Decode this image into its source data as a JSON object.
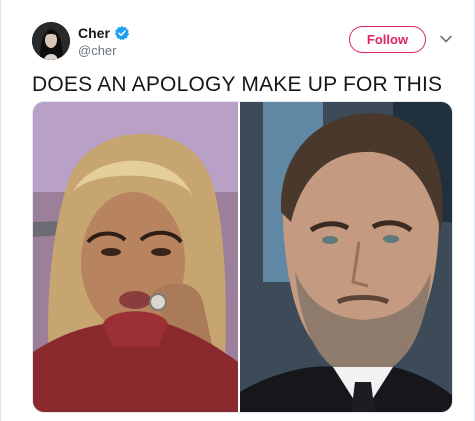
{
  "tweet": {
    "author": {
      "display_name": "Cher",
      "handle": "@cher",
      "verified": true,
      "avatar_icon": "profile-photo"
    },
    "follow_label": "Follow",
    "menu_icon": "chevron-down-icon",
    "text": "DOES AN APOLOGY MAKE UP FOR THIS"
  },
  "colors": {
    "follow_accent": "#e0245e",
    "verified_blue": "#1da1f2",
    "handle_gray": "#657786",
    "text": "#14171a"
  },
  "media": {
    "panels": [
      {
        "description_icon": "photo-left"
      },
      {
        "description_icon": "photo-right"
      }
    ]
  }
}
